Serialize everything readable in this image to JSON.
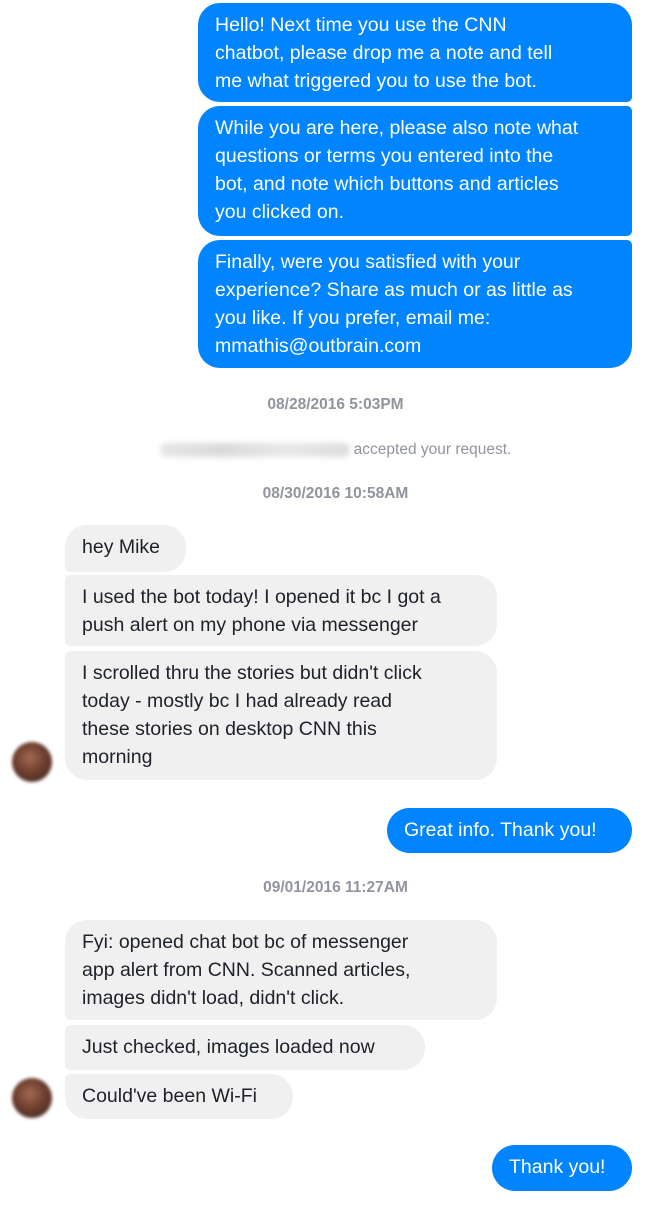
{
  "conversation": {
    "messages": [
      {
        "id": "m1",
        "direction": "sent",
        "text": "Hello! Next time you use the CNN\nchatbot, please drop me a note and tell\nme what triggered you to use the bot."
      },
      {
        "id": "m2",
        "direction": "sent",
        "text": "While you are here, please also note what\nquestions or terms you entered into the\nbot, and note which buttons and articles\nyou clicked on."
      },
      {
        "id": "m3",
        "direction": "sent",
        "text": "Finally, were you satisfied with your\nexperience? Share as much or as little as\nyou like. If you prefer, email me:\nmmathis@outbrain.com"
      },
      {
        "id": "m4",
        "direction": "received",
        "text": "hey Mike"
      },
      {
        "id": "m5",
        "direction": "received",
        "text": "I used the bot today! I opened it bc I got a\npush alert on my phone via messenger"
      },
      {
        "id": "m6",
        "direction": "received",
        "text": "I scrolled thru the stories but didn't click\ntoday - mostly bc I had already read\nthese stories on desktop CNN this\nmorning"
      },
      {
        "id": "m7",
        "direction": "sent",
        "text": "Great info. Thank you!"
      },
      {
        "id": "m8",
        "direction": "received",
        "text": "Fyi: opened chat bot bc of messenger\napp alert from CNN. Scanned articles,\nimages didn't load, didn't click."
      },
      {
        "id": "m9",
        "direction": "received",
        "text": "Just checked, images loaded now"
      },
      {
        "id": "m10",
        "direction": "received",
        "text": "Could've been Wi-Fi"
      },
      {
        "id": "m11",
        "direction": "sent",
        "text": "Thank you!"
      }
    ],
    "timestamps": [
      "08/28/2016 5:03PM",
      "08/30/2016 10:58AM",
      "09/01/2016 11:27AM"
    ],
    "system_event": {
      "text": "accepted your request."
    }
  },
  "colors": {
    "sent_bubble": "#0084ff",
    "received_bubble": "#f1f0f0",
    "meta_text": "#90949c"
  }
}
